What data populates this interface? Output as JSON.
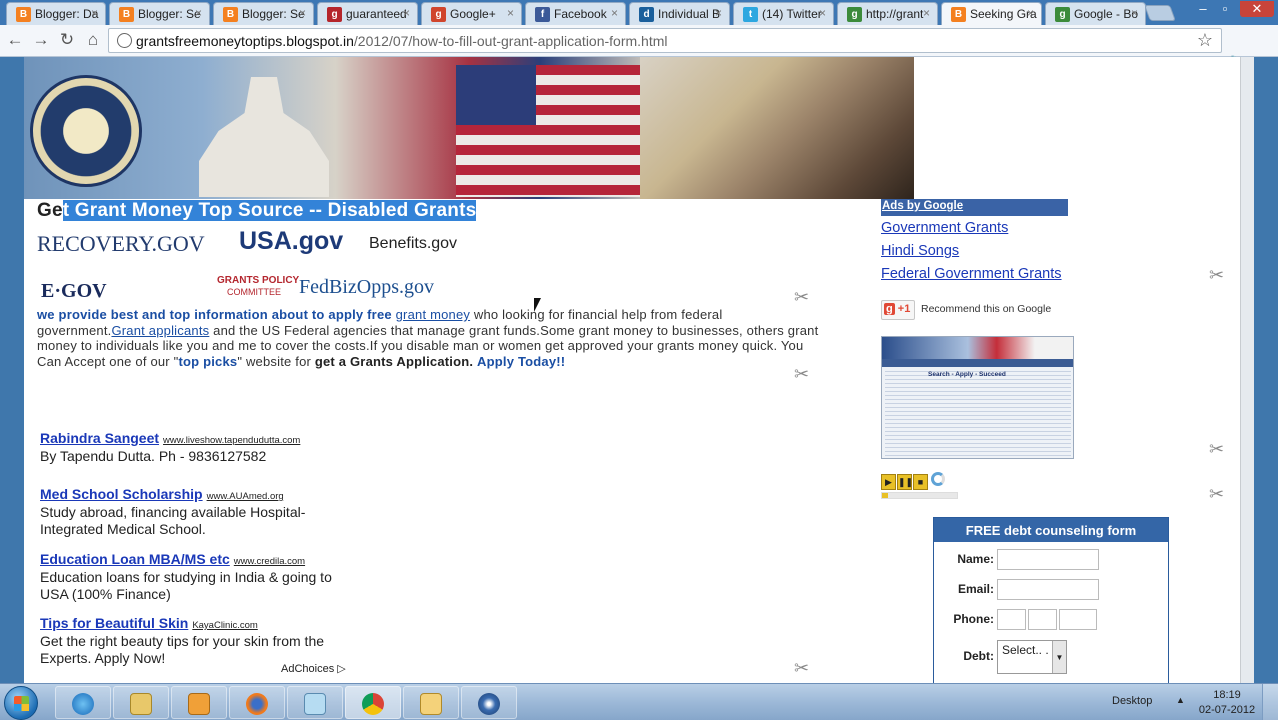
{
  "tabs": [
    {
      "label": "Blogger: Da",
      "icon": "blogger-icon",
      "color": "#f48020"
    },
    {
      "label": "Blogger: Se",
      "icon": "blogger-icon",
      "color": "#f48020"
    },
    {
      "label": "Blogger: Se",
      "icon": "blogger-icon",
      "color": "#f48020"
    },
    {
      "label": "guaranteed",
      "icon": "google-news-icon",
      "color": "#b5252b"
    },
    {
      "label": "Google+",
      "icon": "google-plus-icon",
      "color": "#d0452d"
    },
    {
      "label": "Facebook",
      "icon": "facebook-icon",
      "color": "#3b5998"
    },
    {
      "label": "Individual B",
      "icon": "digg-icon",
      "color": "#1a5f9c"
    },
    {
      "label": "(14) Twitter",
      "icon": "twitter-icon",
      "color": "#2da7e0"
    },
    {
      "label": "http://grant",
      "icon": "google-icon",
      "color": "#3c8b3b"
    },
    {
      "label": "Seeking Gra",
      "icon": "blogger-icon",
      "color": "#f48020"
    },
    {
      "label": "Google - Bo",
      "icon": "google-icon",
      "color": "#3c8b3b"
    }
  ],
  "url": {
    "domain": "grantsfreemoneytoptips.blogspot.in",
    "path": "/2012/07/how-to-fill-out-grant-application-form.html"
  },
  "page": {
    "title_pre": "Ge",
    "title_sel": "t Grant Money Top Source -- Disabled Grants",
    "logos": [
      "RECOVERY.GOV",
      "USA.gov",
      "Benefits.gov",
      "E·GOV",
      "GRANTS POLICY",
      "COMMITTEE",
      "FedBizOpps.gov"
    ],
    "intro": {
      "p1": "we provide best and top information about to apply free",
      "link1": "grant money",
      "p2": "who looking for financial help from federal government.",
      "link2": "Grant applicants",
      "p3": "and the US Federal agencies that manage grant funds.Some grant money to businesses, others grant money to individuals like you and me to cover the costs.If you disable man or women get approved your grants money quick. You Can Accept one of our \"",
      "k1": "top picks",
      "p4": "\" website for",
      "k2": "get a Grants Application.",
      "cta": "Apply Today!!"
    },
    "ads": [
      {
        "title": "Rabindra Sangeet",
        "url": "www.liveshow.tapendudutta.com",
        "desc": "By Tapendu Dutta. Ph - 9836127582"
      },
      {
        "title": "Med School Scholarship",
        "url": "www.AUAmed.org",
        "desc": "Study abroad, financing available Hospital-Integrated Medical School."
      },
      {
        "title": "Education Loan MBA/MS etc",
        "url": "www.credila.com",
        "desc": "Education loans for studying in India & going to USA (100% Finance)"
      },
      {
        "title": "Tips for Beautiful Skin",
        "url": "KayaClinic.com",
        "desc": "Get the right beauty tips for your skin from the Experts. Apply Now!"
      }
    ],
    "adchoices": "AdChoices ▷"
  },
  "sidebar": {
    "ads_by_google": "Ads by Google",
    "links": [
      "Government Grants",
      "Hindi Songs",
      "Federal Government Grants"
    ],
    "plusone": "+1",
    "recommend": "Recommend this on Google",
    "thumb_caption": "Search - Apply - Succeed",
    "player_progress": 0.08,
    "form": {
      "title": "FREE debt counseling form",
      "name_label": "Name:",
      "email_label": "Email:",
      "phone_label": "Phone:",
      "debt_label": "Debt:",
      "debt_value": "Select.. ."
    }
  },
  "taskbar": {
    "desktop": "Desktop",
    "time": "18:19",
    "date": "02-07-2012"
  }
}
